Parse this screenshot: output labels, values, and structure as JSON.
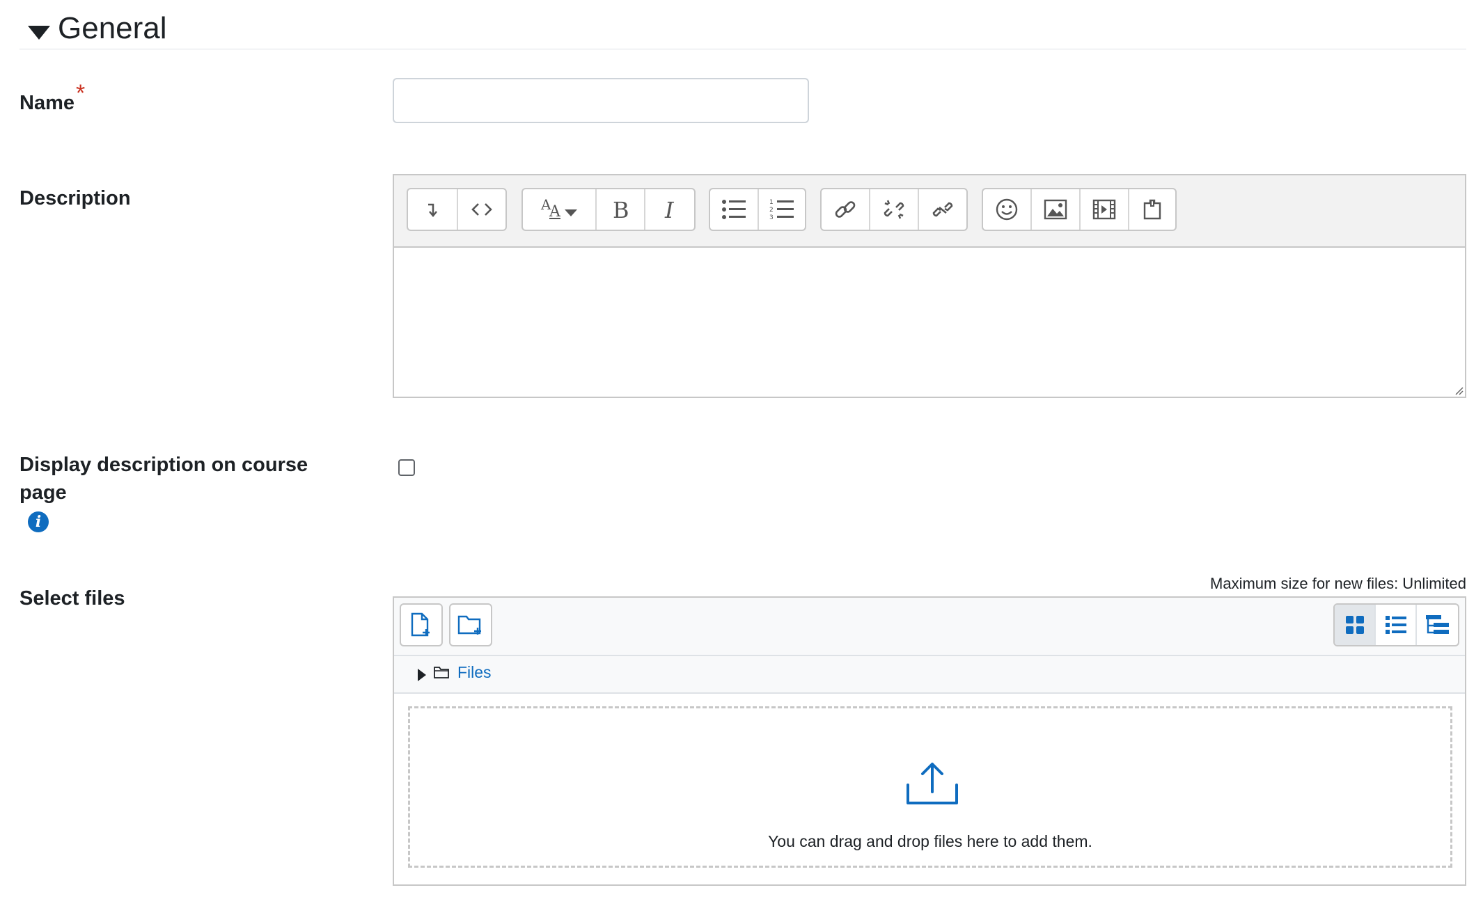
{
  "section": {
    "title": "General"
  },
  "fields": {
    "name": {
      "label": "Name",
      "required_mark": "*",
      "value": ""
    },
    "description": {
      "label": "Description"
    },
    "display_description": {
      "label": "Display description on course page",
      "info_glyph": "i",
      "checked": false
    },
    "select_files": {
      "label": "Select files"
    }
  },
  "editor_toolbar": {
    "groups": [
      [
        "collapse-icon",
        "html-icon"
      ],
      [
        "font-style-icon",
        "bold-icon",
        "italic-icon"
      ],
      [
        "unordered-list-icon",
        "ordered-list-icon"
      ],
      [
        "link-icon",
        "unlink-icon",
        "manage-links-icon"
      ],
      [
        "emoji-icon",
        "image-icon",
        "media-icon",
        "manage-files-icon"
      ]
    ]
  },
  "filemanager": {
    "max_size": "Maximum size for new files: Unlimited",
    "path_folder": "Files",
    "drop_text": "You can drag and drop files here to add them.",
    "toolbar": [
      "add-file-icon",
      "create-folder-icon"
    ],
    "views": [
      "icons-view-icon",
      "list-view-icon",
      "tree-view-icon"
    ],
    "active_view": "icons-view-icon",
    "accent_color": "#0f6cbf"
  }
}
